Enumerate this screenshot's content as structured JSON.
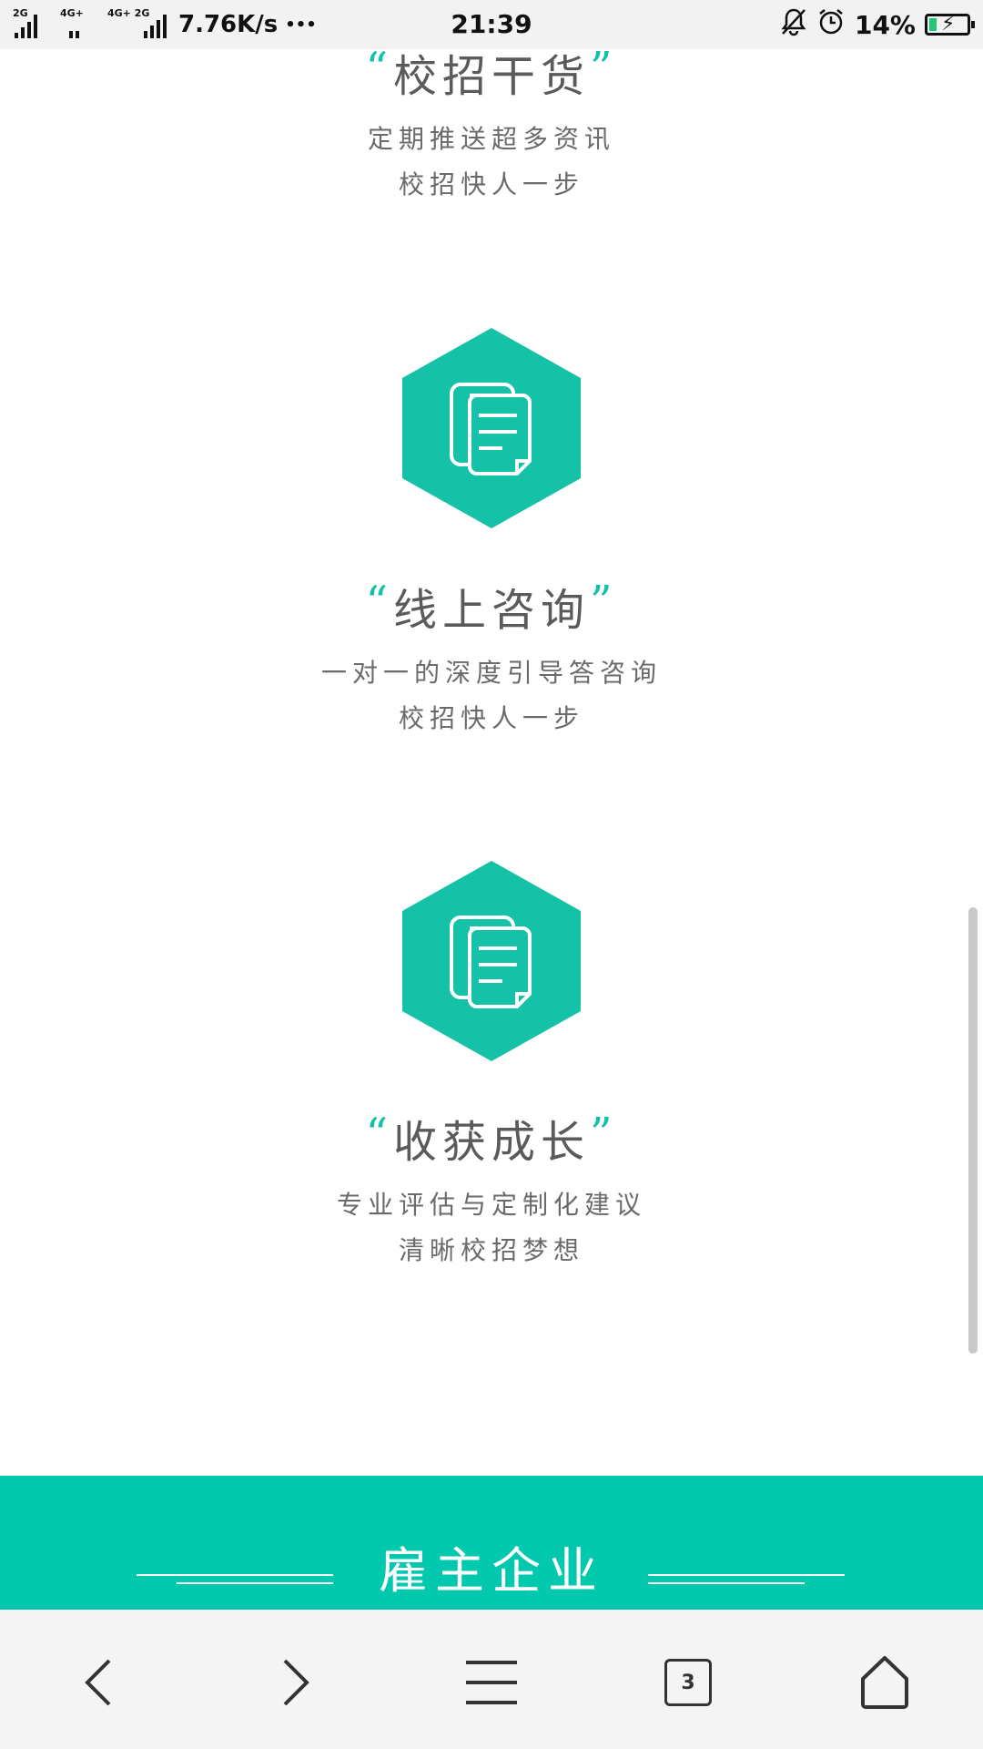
{
  "status_bar": {
    "net_tag_1": "2G",
    "net_tag_2": "4G+",
    "net_tag_3": "4G+ 2G",
    "speed": "7.76K/s",
    "dots": "•••",
    "time": "21:39",
    "battery": "14%"
  },
  "features": [
    {
      "title": "校招干货",
      "desc_line1": "定期推送超多资讯",
      "desc_line2": "校招快人一步"
    },
    {
      "title": "线上咨询",
      "desc_line1": "一对一的深度引导答咨询",
      "desc_line2": "校招快人一步"
    },
    {
      "title": "收获成长",
      "desc_line1": "专业评估与定制化建议",
      "desc_line2": "清晰校招梦想"
    }
  ],
  "quote_open": "“",
  "quote_close": "”",
  "section": {
    "heading": "雇主企业"
  },
  "nav": {
    "tab_count": "3"
  },
  "colors": {
    "accent": "#02c9ad",
    "status_bg": "#f2f2f2",
    "nav_bg": "#f4f4f4"
  },
  "icons": [
    "document-copy-icon",
    "back-icon",
    "forward-icon",
    "menu-icon",
    "tabs-icon",
    "home-icon",
    "bell-off-icon",
    "alarm-icon",
    "battery-charging-icon"
  ]
}
